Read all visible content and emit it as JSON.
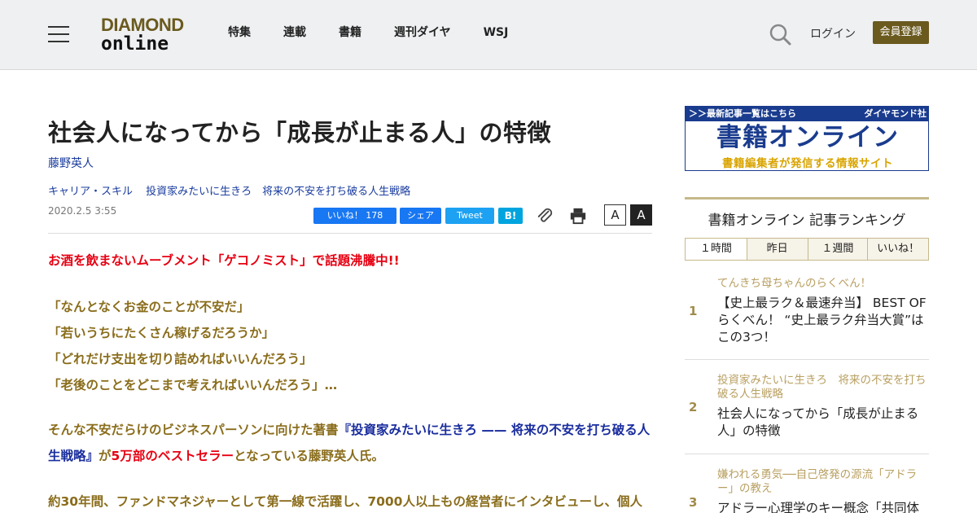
{
  "header": {
    "logo_line1": "DIAMOND",
    "logo_line2": "online",
    "nav": [
      "特集",
      "連載",
      "書籍",
      "週刊ダイヤ",
      "WSJ"
    ],
    "login_label": "ログイン",
    "register_label": "会員登録"
  },
  "article": {
    "title": "社会人になってから「成長が止まる人」の特徴",
    "author": "藤野英人",
    "tags": [
      "キャリア・スキル",
      "投資家みたいに生きろ　将来の不安を打ち破る人生戦略"
    ],
    "date": "2020.2.5 3:55",
    "share": {
      "facebook_label": "いいね！ 178",
      "share_label": "シェア",
      "tweet_label": "Tweet",
      "hatena_label": "B!"
    },
    "font_small_label": "A",
    "font_large_label": "A",
    "lead": "お酒を飲まないムーブメント「ゲコノミスト」で話題沸騰中!!",
    "quotes": [
      "「なんとなくお金のことが不安だ」",
      "「若いうちにたくさん稼げるだろうか」",
      "「どれだけ支出を切り詰めればいいんだろう」",
      "「老後のことをどこまで考えればいいんだろう」…"
    ],
    "para1": {
      "part1": "そんな不安だらけのビジネスパーソンに向けた著書",
      "book": "『投資家みたいに生きろ —— 将来の不安を打ち破る人生戦略』",
      "part2": "が",
      "sales": "5万部のベストセラー",
      "part3": "となっている藤野英人氏。"
    },
    "para2": "約30年間、ファンドマネジャーとして第一線で活躍し、7000人以上もの経営者にインタビューし、個人"
  },
  "sidebar": {
    "banner": {
      "top_text": "＞＞最新記事一覧はこちら",
      "publisher": "ダイヤモンド社",
      "big_text": "書籍オンライン",
      "sub_text": "書籍編集者が発信する情報サイト"
    },
    "ranking_title": "書籍オンライン 記事ランキング",
    "tabs": [
      "１時間",
      "昨日",
      "１週間",
      "いいね！"
    ],
    "items": [
      {
        "num": "1",
        "category": "てんきち母ちゃんのらくべん！",
        "headline": "【史上最ラク＆最速弁当】 BEST OF らくべん！ “史上最ラク弁当大賞”は この3つ！"
      },
      {
        "num": "2",
        "category": "投資家みたいに生きろ　将来の不安を打ち破る人生戦略",
        "headline": "社会人になってから「成長が止まる人」の特徴"
      },
      {
        "num": "3",
        "category": "嫌われる勇気──自己啓発の源流「アドラー」の教え",
        "headline": "アドラー心理学のキー概念「共同体"
      }
    ]
  },
  "colors": {
    "accent_gold": "#6b5a1e",
    "body_gold": "#8a6d1c",
    "emphasis_red": "#e60012",
    "link_blue": "#1a3c9e"
  }
}
